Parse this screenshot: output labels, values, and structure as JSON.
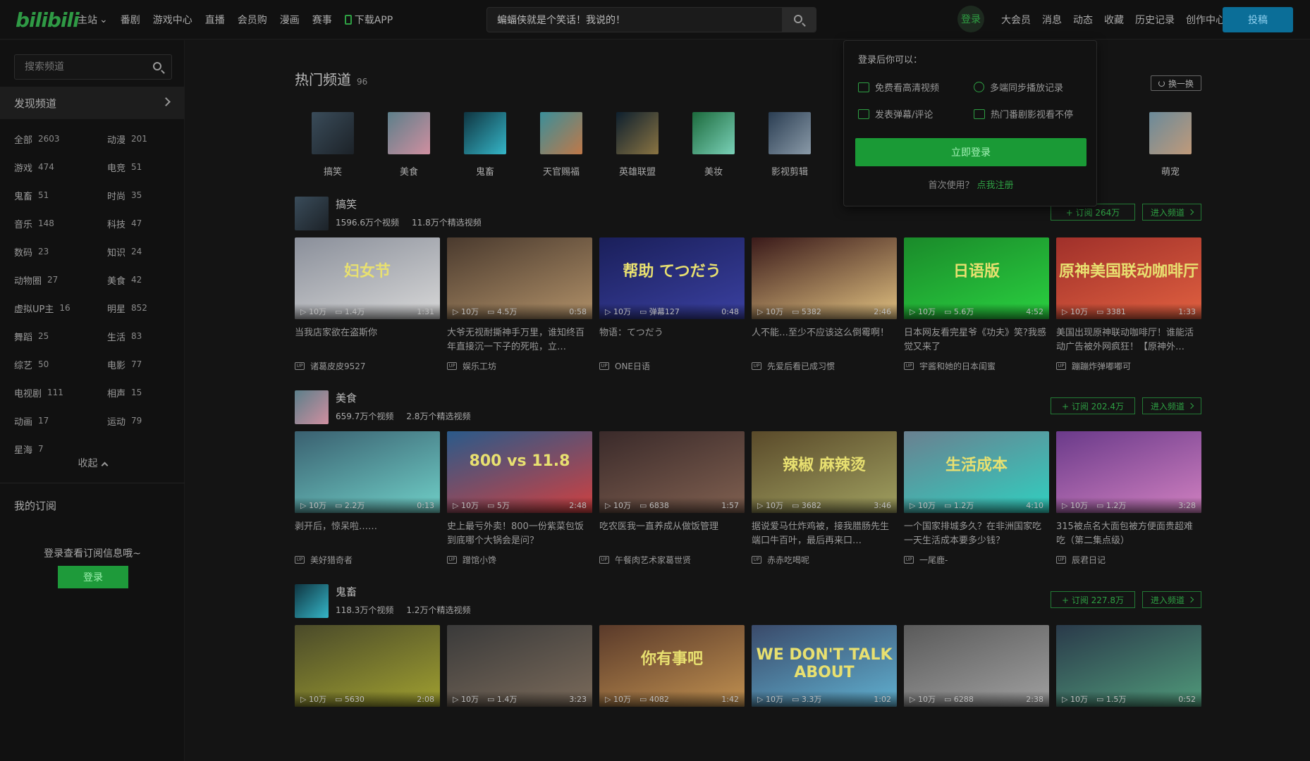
{
  "header": {
    "logo": "bilibili",
    "nav": [
      {
        "label": "主站",
        "caret": true
      },
      {
        "label": "番剧"
      },
      {
        "label": "游戏中心"
      },
      {
        "label": "直播"
      },
      {
        "label": "会员购"
      },
      {
        "label": "漫画"
      },
      {
        "label": "赛事"
      },
      {
        "label": "下载APP",
        "icon": "phone-icon"
      }
    ],
    "search_value": "蝙蝠侠就是个笑话！我说的！",
    "login": "登录",
    "links": [
      "大会员",
      "消息",
      "动态",
      "收藏",
      "历史记录",
      "创作中心"
    ],
    "upload": "投稿"
  },
  "sidebar": {
    "search_placeholder": "搜索频道",
    "discover": "发现频道",
    "categories": [
      {
        "name": "全部",
        "count": "2603"
      },
      {
        "name": "动漫",
        "count": "201"
      },
      {
        "name": "游戏",
        "count": "474"
      },
      {
        "name": "电竞",
        "count": "51"
      },
      {
        "name": "鬼畜",
        "count": "51"
      },
      {
        "name": "时尚",
        "count": "35"
      },
      {
        "name": "音乐",
        "count": "148"
      },
      {
        "name": "科技",
        "count": "47"
      },
      {
        "name": "数码",
        "count": "23"
      },
      {
        "name": "知识",
        "count": "24"
      },
      {
        "name": "动物圈",
        "count": "27"
      },
      {
        "name": "美食",
        "count": "42"
      },
      {
        "name": "虚拟UP主",
        "count": "16"
      },
      {
        "name": "明星",
        "count": "852"
      },
      {
        "name": "舞蹈",
        "count": "25"
      },
      {
        "name": "生活",
        "count": "83"
      },
      {
        "name": "综艺",
        "count": "50"
      },
      {
        "name": "电影",
        "count": "77"
      },
      {
        "name": "电视剧",
        "count": "111"
      },
      {
        "name": "相声",
        "count": "15"
      },
      {
        "name": "动画",
        "count": "17"
      },
      {
        "name": "运动",
        "count": "79"
      },
      {
        "name": "星海",
        "count": "7"
      }
    ],
    "collapse": "收起",
    "my_subs": "我的订阅",
    "login_tip": "登录查看订阅信息哦~",
    "login_btn": "登录"
  },
  "hot": {
    "title": "热门频道",
    "count": "96",
    "swap": "换一换",
    "items": [
      "搞笑",
      "美食",
      "鬼畜",
      "天官赐福",
      "英雄联盟",
      "美妆",
      "影视剪辑",
      "",
      "",
      "",
      "",
      "萌宠"
    ]
  },
  "popover": {
    "title": "登录后你可以：",
    "features": [
      "免费看高清视频",
      "多端同步播放记录",
      "发表弹幕/评论",
      "热门番剧影视看不停"
    ],
    "login": "立即登录",
    "first_use": "首次使用？",
    "register": "点我注册"
  },
  "sections": [
    {
      "name": "搞笑",
      "videos_count": "1596.6万个视频",
      "picks_count": "11.8万个精选视频",
      "subscribe": "+ 订阅 264万",
      "enter": "进入频道",
      "cards": [
        {
          "title": "当我店家欲在盗斯你",
          "up": "诸葛皮皮9527",
          "play": "10万",
          "dm": "1.4万",
          "dur": "1:31",
          "caption": "妇女节"
        },
        {
          "title": "大爷无视耐撕神手万里，谁知终百年直接沉一下子的死啦，立…",
          "up": "娱乐工坊",
          "play": "10万",
          "dm": "4.5万",
          "dur": "0:58",
          "caption": ""
        },
        {
          "title": "物语：てつだう",
          "up": "ONE日语",
          "play": "10万",
          "dm": "弹幕127",
          "dur": "0:48",
          "caption": "帮助 てつだう"
        },
        {
          "title": "人不能…至少不应该这么倒霉啊！",
          "up": "先爱后看已成习惯",
          "play": "10万",
          "dm": "5382",
          "dur": "2:46",
          "caption": ""
        },
        {
          "title": "日本网友看完星爷《功夫》笑?我感觉又来了",
          "up": "宇酱和她的日本闺蜜",
          "play": "10万",
          "dm": "5.6万",
          "dur": "4:52",
          "caption": "日语版"
        },
        {
          "title": "美国出现原神联动咖啡厅！谁能活动广告被外网疯狂！【原神外…",
          "up": "蹦蹦炸弹嘟嘟可",
          "play": "10万",
          "dm": "3381",
          "dur": "1:33",
          "caption": "原神美国联动咖啡厅"
        }
      ]
    },
    {
      "name": "美食",
      "videos_count": "659.7万个视频",
      "picks_count": "2.8万个精选视频",
      "subscribe": "+ 订阅 202.4万",
      "enter": "进入频道",
      "cards": [
        {
          "title": "剥开后，惊呆啦……",
          "up": "美好猎奇者",
          "play": "10万",
          "dm": "2.2万",
          "dur": "0:13",
          "caption": ""
        },
        {
          "title": "史上最亏外卖！800一份紫菜包饭到底哪个大锅会是问？",
          "up": "蹭馆小馋",
          "play": "10万",
          "dm": "5万",
          "dur": "2:48",
          "caption": "800 vs 11.8"
        },
        {
          "title": "吃农医我一直养成从做饭管理",
          "up": "午餐肉艺术家葛世贤",
          "play": "10万",
          "dm": "6838",
          "dur": "1:57",
          "caption": ""
        },
        {
          "title": "据说爱马仕炸鸡被，接我腊肠先生端口牛百叶，最后再来口…",
          "up": "赤赤吃喝呢",
          "play": "10万",
          "dm": "3682",
          "dur": "3:46",
          "caption": "辣椒 麻辣烫"
        },
        {
          "title": "一个国家排城多久？在非洲国家吃一天生活成本要多少钱？",
          "up": "一尾鹿-",
          "play": "10万",
          "dm": "1.2万",
          "dur": "4:10",
          "caption": "生活成本"
        },
        {
          "title": "315被点名大面包被方便面贵超难吃（第二集点级）",
          "up": "辰君日记",
          "play": "10万",
          "dm": "1.2万",
          "dur": "3:28",
          "caption": ""
        }
      ]
    },
    {
      "name": "鬼畜",
      "videos_count": "118.3万个视频",
      "picks_count": "1.2万个精选视频",
      "subscribe": "+ 订阅 227.8万",
      "enter": "进入频道",
      "cards": [
        {
          "title": "",
          "up": "",
          "play": "10万",
          "dm": "5630",
          "dur": "2:08",
          "caption": ""
        },
        {
          "title": "",
          "up": "",
          "play": "10万",
          "dm": "1.4万",
          "dur": "3:23",
          "caption": ""
        },
        {
          "title": "",
          "up": "",
          "play": "10万",
          "dm": "4082",
          "dur": "1:42",
          "caption": "你有事吧"
        },
        {
          "title": "",
          "up": "",
          "play": "10万",
          "dm": "3.3万",
          "dur": "1:02",
          "caption": "WE DON'T TALK ABOUT"
        },
        {
          "title": "",
          "up": "",
          "play": "10万",
          "dm": "6288",
          "dur": "2:38",
          "caption": ""
        },
        {
          "title": "",
          "up": "",
          "play": "10万",
          "dm": "1.5万",
          "dur": "0:52",
          "caption": ""
        }
      ]
    }
  ],
  "colors": {
    "accent": "#2ea043",
    "upload": "#0b6e98",
    "background": "#141414"
  }
}
